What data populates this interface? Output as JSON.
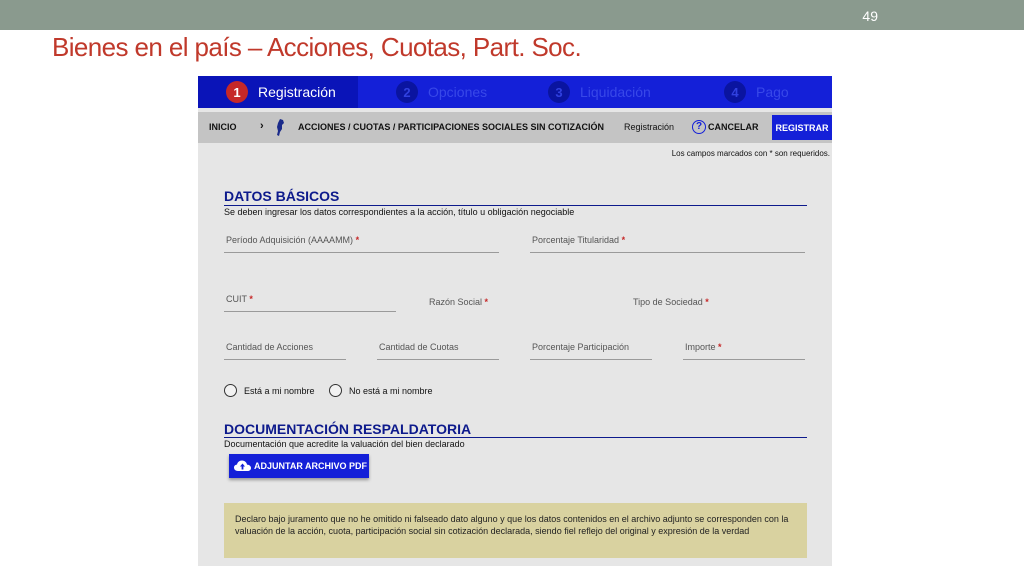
{
  "slide": {
    "number": "49",
    "title": "Bienes en el país – Acciones, Cuotas, Part. Soc."
  },
  "steps": [
    {
      "num": "1",
      "label": "Registración"
    },
    {
      "num": "2",
      "label": "Opciones"
    },
    {
      "num": "3",
      "label": "Liquidación"
    },
    {
      "num": "4",
      "label": "Pago"
    }
  ],
  "breadcrumb": {
    "inicio": "INICIO",
    "sep": "›",
    "section": "ACCIONES / CUOTAS / PARTICIPACIONES SOCIALES SIN COTIZACIÓN",
    "current": "Registración",
    "help_glyph": "?",
    "cancel": "CANCELAR",
    "register": "REGISTRAR"
  },
  "required_note": "Los campos marcados con * son requeridos.",
  "datos_basicos": {
    "title": "DATOS BÁSICOS",
    "subtitle": "Se deben ingresar los datos correspondientes a la acción, título u obligación negociable",
    "fields": {
      "periodo": "Período Adquisición (AAAAMM)",
      "porcentaje_titularidad": "Porcentaje Titularidad",
      "cuit": "CUIT",
      "razon_social": "Razón Social",
      "tipo_sociedad": "Tipo de Sociedad",
      "cantidad_acciones": "Cantidad de Acciones",
      "cantidad_cuotas": "Cantidad de Cuotas",
      "porcentaje_participacion": "Porcentaje Participación",
      "importe": "Importe"
    },
    "required_mark": "*",
    "radios": {
      "a_mi_nombre": "Está a mi nombre",
      "no_a_mi_nombre": "No está a mi nombre"
    }
  },
  "documentacion": {
    "title": "DOCUMENTACIÓN RESPALDATORIA",
    "subtitle": "Documentación que acredite la valuación del bien declarado",
    "upload_label": "ADJUNTAR ARCHIVO PDF"
  },
  "declaration": "Declaro bajo juramento que no he omitido ni falseado dato alguno  y que  los datos contenidos en el archivo adjunto se corresponden con la valuación de la acción, cuota, participación social sin cotización declarada, siendo fiel reflejo del original y expresión de la verdad",
  "colors": {
    "title_red": "#c0392b",
    "primary_blue": "#1420d8",
    "heading_navy": "#0d1a8c",
    "declaration_bg": "#d9d2a0"
  },
  "icons": {
    "flag": "argentina-map-icon",
    "help": "help-circle-icon",
    "upload": "cloud-upload-icon"
  }
}
